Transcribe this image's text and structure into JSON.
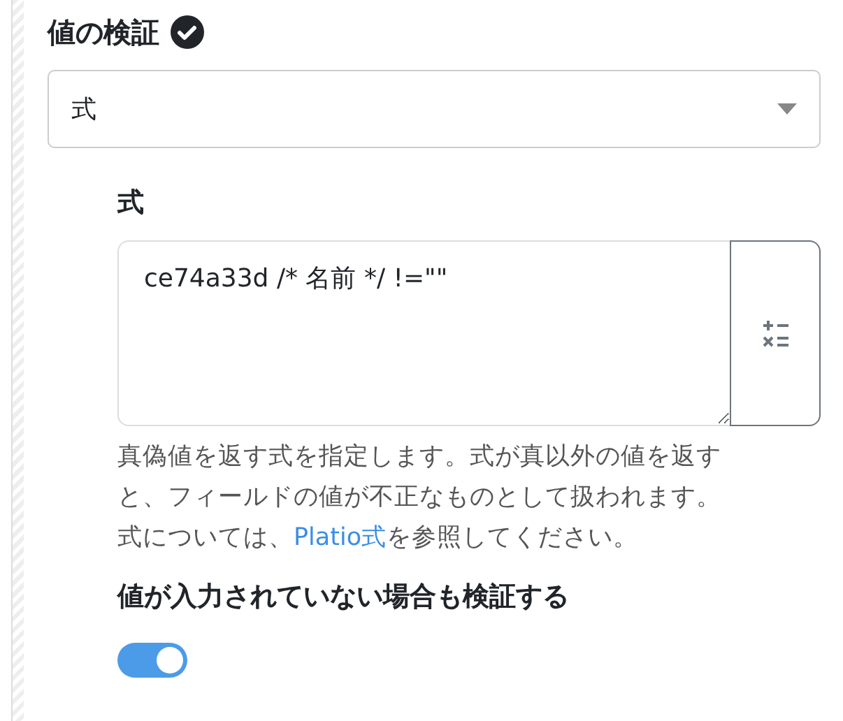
{
  "section": {
    "title": "値の検証",
    "verified": true
  },
  "validation_type": {
    "value": "式"
  },
  "expression": {
    "label": "式",
    "value": "ce74a33d /* 名前 */ !=\"\"",
    "help_before": "真偽値を返す式を指定します。式が真以外の値を返すと、フィールドの値が不正なものとして扱われます。式については、",
    "help_link": "Platio式",
    "help_after": "を参照してください。"
  },
  "validate_empty": {
    "label": "値が入力されていない場合も検証する",
    "on": true
  }
}
